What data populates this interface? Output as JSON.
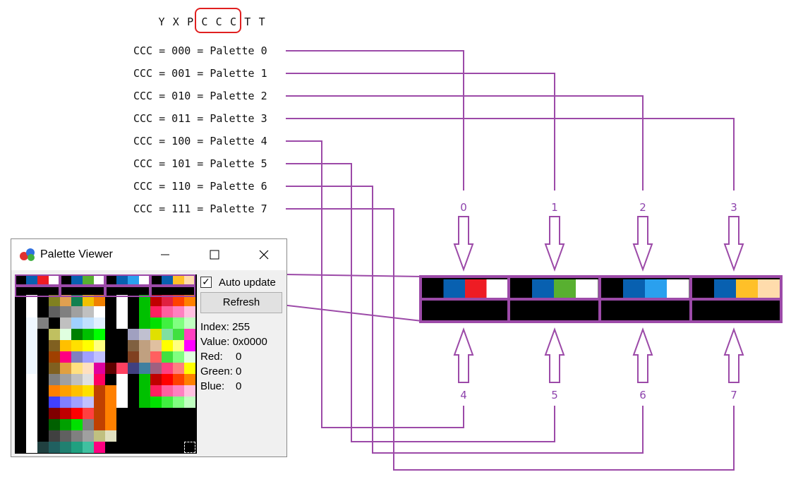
{
  "bit_pattern": {
    "letters": [
      "Y",
      "X",
      "P",
      "C",
      "C",
      "C",
      "T",
      "T"
    ],
    "highlight_color": "#e02020"
  },
  "mappings": [
    {
      "bits": "CCC = 000 = Palette 0"
    },
    {
      "bits": "CCC = 001 = Palette 1"
    },
    {
      "bits": "CCC = 010 = Palette 2"
    },
    {
      "bits": "CCC = 011 = Palette 3"
    },
    {
      "bits": "CCC = 100 = Palette 4"
    },
    {
      "bits": "CCC = 101 = Palette 5"
    },
    {
      "bits": "CCC = 110 = Palette 6"
    },
    {
      "bits": "CCC = 111 = Palette 7"
    }
  ],
  "palette_numbers_top": [
    "0",
    "1",
    "2",
    "3"
  ],
  "palette_numbers_bottom": [
    "4",
    "5",
    "6",
    "7"
  ],
  "line_color": "#9c4aa8",
  "palettes_top": [
    [
      "#000000",
      "#0860b0",
      "#ee1c24",
      "#ffffff"
    ],
    [
      "#000000",
      "#0860b0",
      "#58b030",
      "#ffffff"
    ],
    [
      "#000000",
      "#0860b0",
      "#2aa0ee",
      "#ffffff"
    ],
    [
      "#000000",
      "#0860b0",
      "#ffc028",
      "#ffdcac"
    ]
  ],
  "palettes_bottom": [
    [
      "#000000",
      "#000000",
      "#000000",
      "#000000"
    ],
    [
      "#000000",
      "#000000",
      "#000000",
      "#000000"
    ],
    [
      "#000000",
      "#000000",
      "#000000",
      "#000000"
    ],
    [
      "#000000",
      "#000000",
      "#000000",
      "#000000"
    ]
  ],
  "palette_viewer": {
    "title": "Palette Viewer",
    "icon": "app-icon",
    "minimize_icon": "minimize-icon",
    "maximize_icon": "maximize-icon",
    "close_icon": "close-icon",
    "auto_update_label": "Auto update",
    "auto_update_checked": true,
    "refresh_label": "Refresh",
    "index_label": "Index: 255",
    "value_label": "Value: 0x0000",
    "red_label": "Red:",
    "red_value": "0",
    "green_label": "Green:",
    "green_value": "0",
    "blue_label": "Blue:",
    "blue_value": "0"
  }
}
